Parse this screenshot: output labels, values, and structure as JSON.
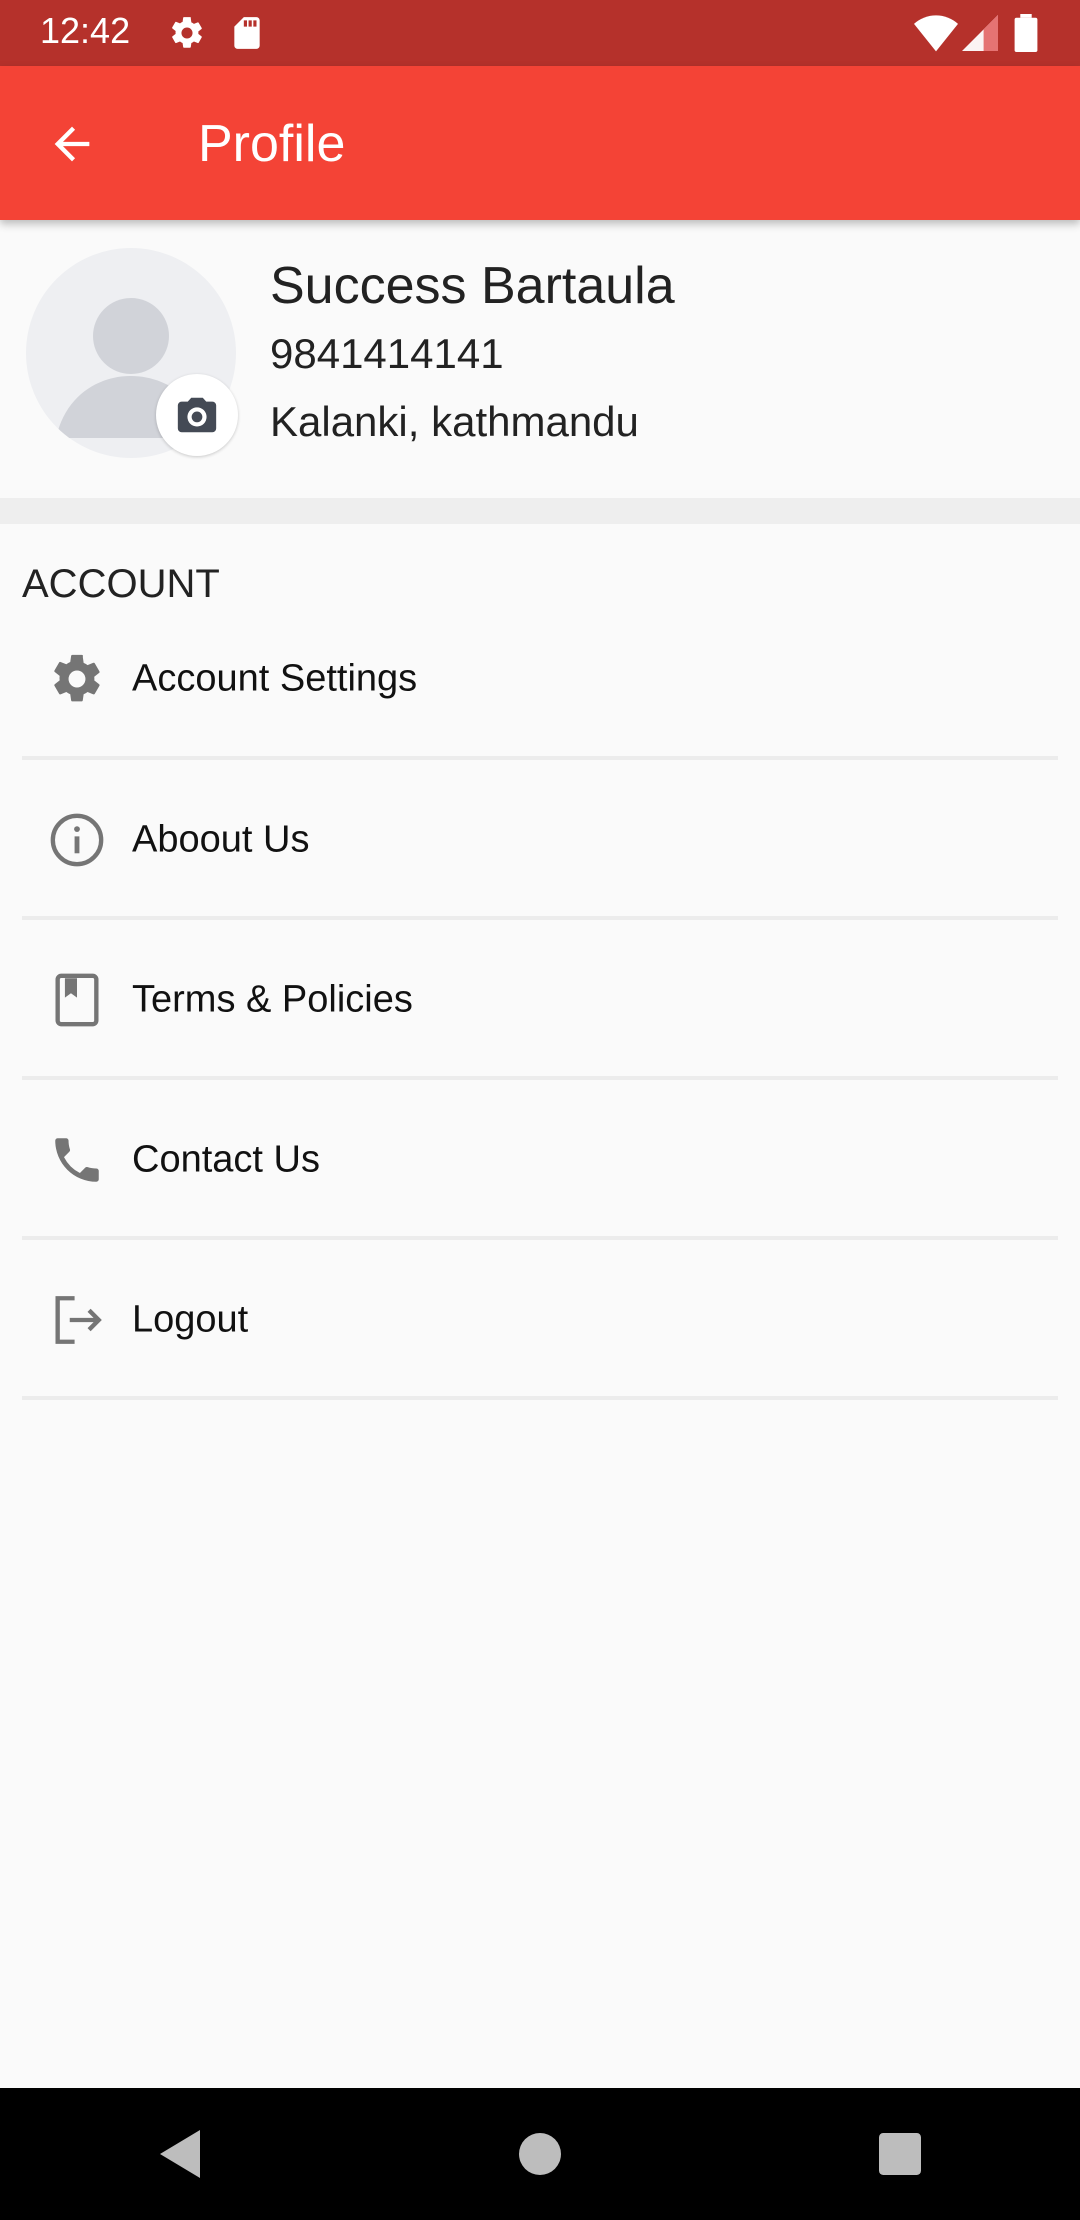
{
  "status_bar": {
    "time": "12:42",
    "icons": [
      "settings-icon",
      "sd-card-icon",
      "wifi-icon",
      "signal-icon",
      "battery-icon"
    ]
  },
  "app_bar": {
    "title": "Profile",
    "back_icon": "arrow-back-icon",
    "color": "#f44336"
  },
  "profile": {
    "name": "Success Bartaula",
    "phone": "9841414141",
    "address": "Kalanki, kathmandu",
    "avatar_icon": "person-placeholder-icon",
    "camera_icon": "camera-icon"
  },
  "section": {
    "title": "ACCOUNT"
  },
  "menu": {
    "items": [
      {
        "label": "Account Settings",
        "icon": "gear-icon"
      },
      {
        "label": "Aboout Us",
        "icon": "info-icon"
      },
      {
        "label": "Terms & Policies",
        "icon": "book-icon"
      },
      {
        "label": "Contact Us",
        "icon": "phone-icon"
      },
      {
        "label": "Logout",
        "icon": "logout-icon"
      }
    ]
  },
  "nav_bar": {
    "buttons": [
      "back-triangle-icon",
      "home-circle-icon",
      "recents-square-icon"
    ]
  }
}
